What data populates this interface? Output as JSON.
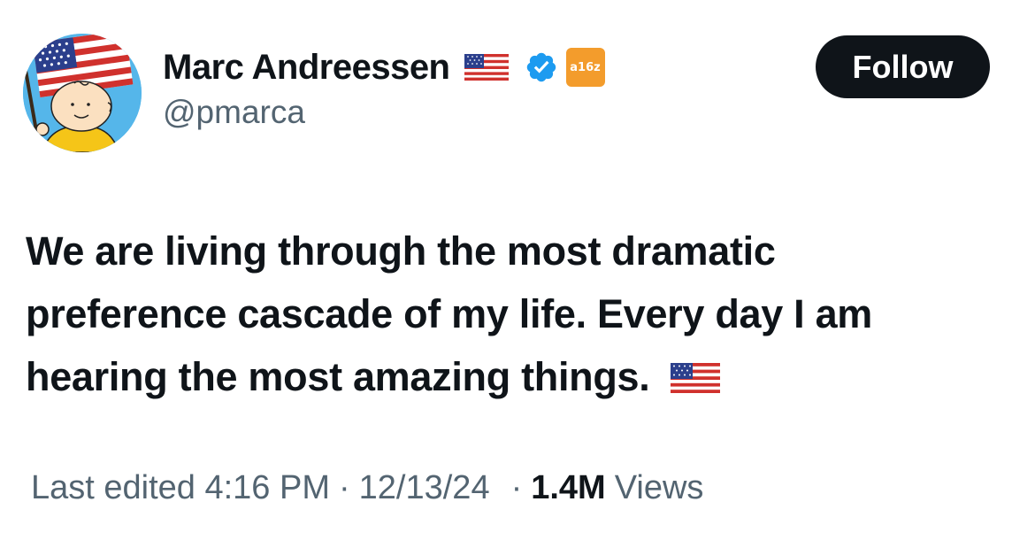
{
  "author": {
    "display_name": "Marc Andreessen",
    "handle": "@pmarca",
    "org_badge_text": "a16z",
    "flag_icon": "us-flag-emoji",
    "verified_icon": "verified-badge-icon",
    "verified_color": "#1d9bf0",
    "org_badge_color": "#f39c2c"
  },
  "follow_button": {
    "label": "Follow"
  },
  "tweet": {
    "text_lines": [
      "We are living through the most dramatic",
      "preference cascade of my life. Every day I am",
      "hearing the most amazing things."
    ],
    "trailing_emoji": "us-flag-emoji"
  },
  "meta": {
    "edited": "Last edited 4:16 PM",
    "separator": "·",
    "date": "12/13/24",
    "views_count": "1.4M",
    "views_label": "Views"
  },
  "colors": {
    "text_primary": "#0f1419",
    "text_secondary": "#536471",
    "button_bg": "#0f1419",
    "button_text": "#ffffff"
  }
}
